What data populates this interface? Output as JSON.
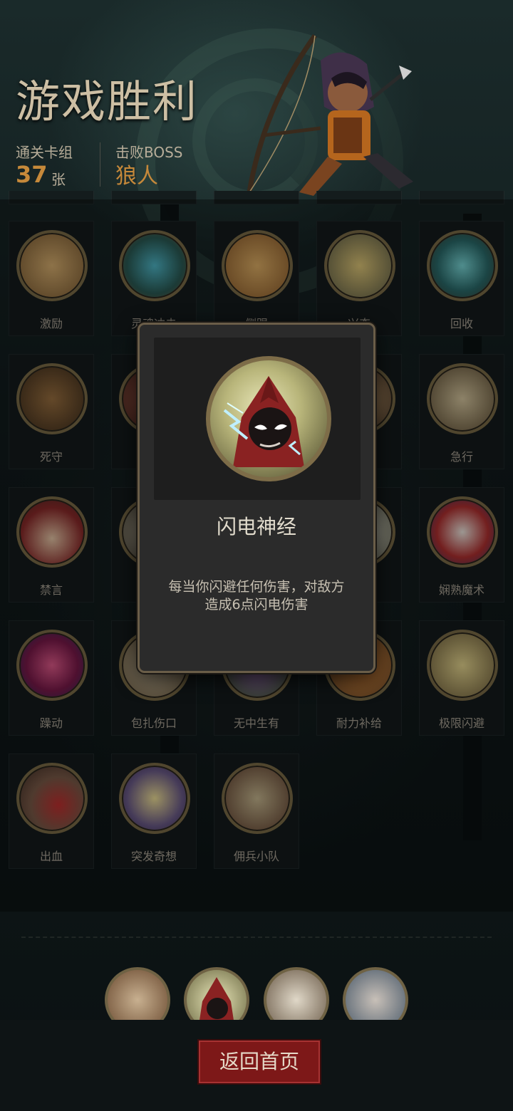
{
  "header": {
    "title": "游戏胜利",
    "stats": {
      "deck_label": "通关卡组",
      "deck_count": "37",
      "deck_unit": "张",
      "boss_label": "击败BOSS",
      "boss_name": "狼人"
    }
  },
  "cards": [
    {
      "label": "激励",
      "icon": "hammer-warrior-icon"
    },
    {
      "label": "灵魂冲击",
      "icon": "spirit-blast-icon"
    },
    {
      "label": "侧踢",
      "icon": "kick-icon"
    },
    {
      "label": "兴奋",
      "icon": "excited-dwarf-icon"
    },
    {
      "label": "回收",
      "icon": "recycle-swirl-icon"
    },
    {
      "label": "死守",
      "icon": "defend-icon"
    },
    {
      "label": "",
      "icon": "hidden-card-icon"
    },
    {
      "label": "",
      "icon": "hidden-card-icon"
    },
    {
      "label": "",
      "icon": "hidden-card-icon"
    },
    {
      "label": "急行",
      "icon": "dash-icon"
    },
    {
      "label": "禁言",
      "icon": "silence-icon"
    },
    {
      "label": "",
      "icon": "hidden-card-icon"
    },
    {
      "label": "",
      "icon": "hidden-card-icon"
    },
    {
      "label": "",
      "icon": "hidden-card-icon"
    },
    {
      "label": "娴熟魔术",
      "icon": "magic-rabbit-icon"
    },
    {
      "label": "躁动",
      "icon": "frenzy-icon"
    },
    {
      "label": "包扎伤口",
      "icon": "bandage-icon"
    },
    {
      "label": "无中生有",
      "icon": "creation-icon"
    },
    {
      "label": "耐力补给",
      "icon": "stamina-icon"
    },
    {
      "label": "极限闪避",
      "icon": "dodge-icon"
    },
    {
      "label": "出血",
      "icon": "bleed-icon"
    },
    {
      "label": "突发奇想",
      "icon": "idea-icon"
    },
    {
      "label": "佣兵小队",
      "icon": "mercenary-icon"
    }
  ],
  "modal": {
    "name": "闪电神经",
    "description": "每当你闪避任何伤害，对敌方造成6点闪电伤害",
    "icon": "lightning-hood-icon"
  },
  "deck_bar": [
    "scythe-icon",
    "lightning-hood-icon",
    "brawler-icon",
    "card-hand-icon"
  ],
  "footer": {
    "home_button": "返回首页"
  },
  "colors": {
    "accent": "#c6893a",
    "button": "#7d1818",
    "frame": "#7c6c48"
  }
}
